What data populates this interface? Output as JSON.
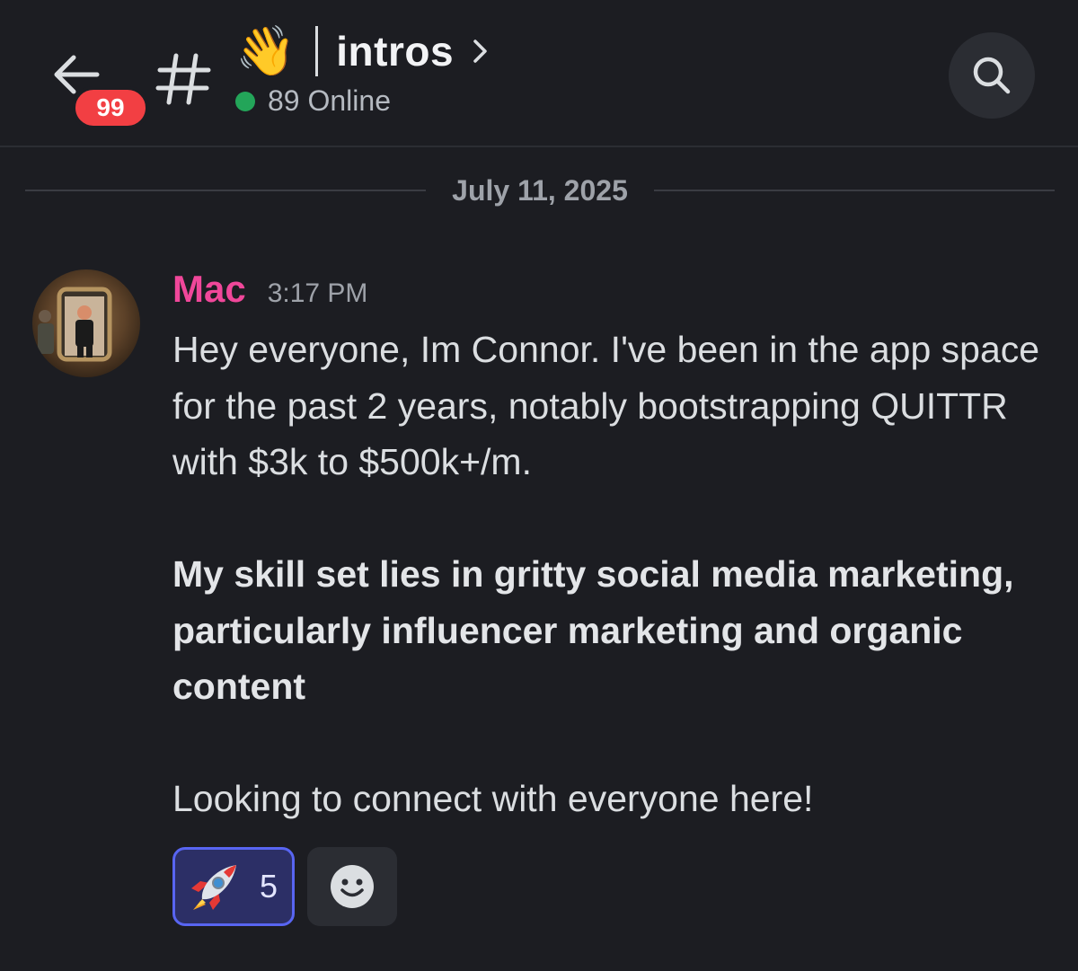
{
  "header": {
    "unread_count": "99",
    "channel_emoji": "👋",
    "channel_name": "intros",
    "online_text": "89 Online",
    "colors": {
      "badge": "#f23f43",
      "online": "#23a559"
    },
    "icons": {
      "back": "arrow-left-icon",
      "channel": "hash-icon",
      "chevron": "chevron-right-icon",
      "search": "search-icon"
    }
  },
  "divider": {
    "date": "July 11, 2025"
  },
  "message": {
    "author": "Mac",
    "author_color": "#f0479a",
    "timestamp": "3:17 PM",
    "paragraph_1": "Hey everyone, Im Connor. I've been in the app space for the past 2 years, notably bootstrapping QUITTR with $3k to $500k+/m.",
    "paragraph_2": "My skill set lies in gritty social media marketing, particularly influencer marketing and organic content",
    "paragraph_3": "Looking to connect with everyone here!"
  },
  "reactions": {
    "items": [
      {
        "emoji": "rocket-icon",
        "count": "5",
        "selected": true
      }
    ],
    "add_icon": "smiley-face-icon"
  }
}
